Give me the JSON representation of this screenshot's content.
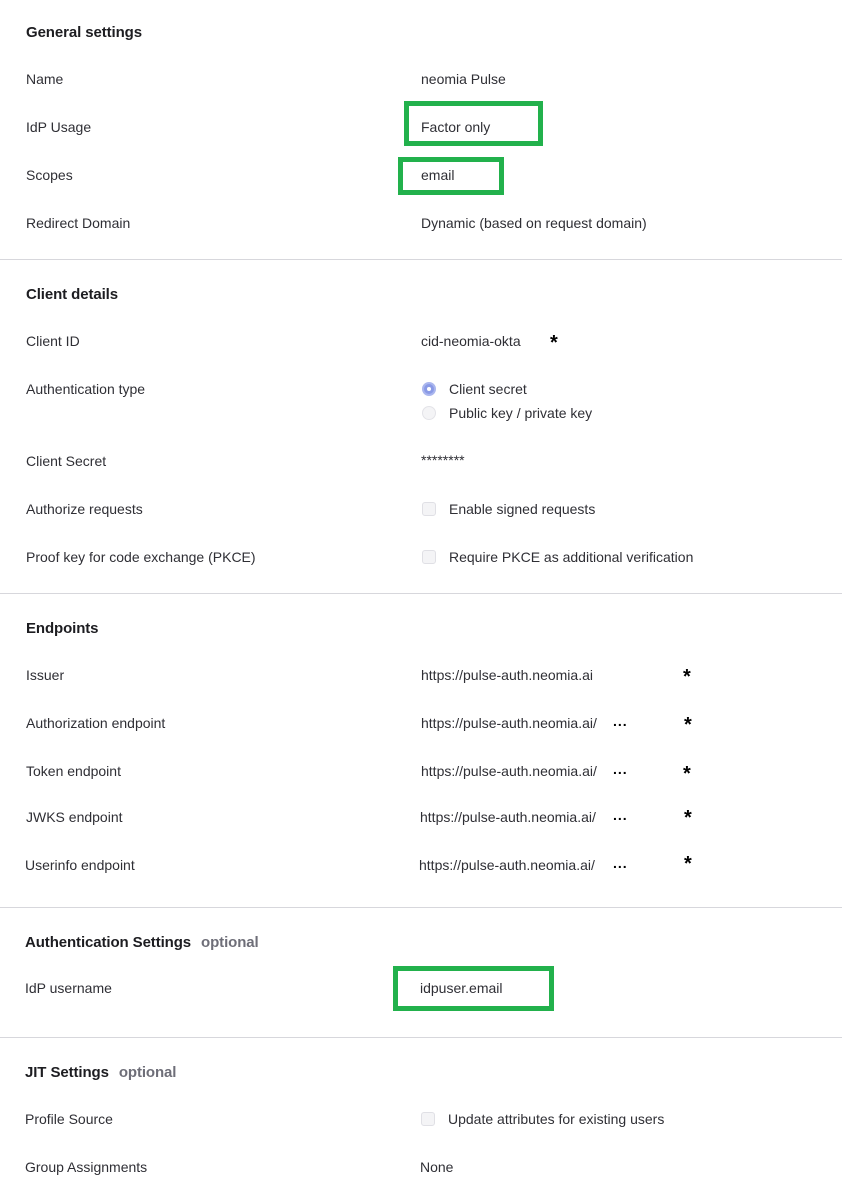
{
  "general": {
    "title": "General settings",
    "name_label": "Name",
    "name_value": "neomia Pulse",
    "idp_usage_label": "IdP Usage",
    "idp_usage_value": "Factor only",
    "scopes_label": "Scopes",
    "scopes_value": "email",
    "redirect_label": "Redirect Domain",
    "redirect_value": "Dynamic (based on request domain)"
  },
  "client": {
    "title": "Client details",
    "client_id_label": "Client ID",
    "client_id_value": "cid-neomia-okta",
    "auth_type_label": "Authentication type",
    "auth_type_options": [
      "Client secret",
      "Public key / private key"
    ],
    "auth_type_selected": "Client secret",
    "secret_label": "Client Secret",
    "secret_value": "********",
    "authorize_label": "Authorize requests",
    "authorize_option": "Enable signed requests",
    "pkce_label": "Proof key for code exchange (PKCE)",
    "pkce_option": "Require PKCE as additional verification"
  },
  "endpoints": {
    "title": "Endpoints",
    "issuer_label": "Issuer",
    "issuer_value": "https://pulse-auth.neomia.ai",
    "authorization_label": "Authorization endpoint",
    "authorization_value": "https://pulse-auth.neomia.ai/",
    "token_label": "Token endpoint",
    "token_value": "https://pulse-auth.neomia.ai/",
    "jwks_label": "JWKS endpoint",
    "jwks_value": "https://pulse-auth.neomia.ai/",
    "userinfo_label": "Userinfo endpoint",
    "userinfo_value": "https://pulse-auth.neomia.ai/"
  },
  "auth_settings": {
    "title": "Authentication Settings",
    "optional": "optional",
    "username_label": "IdP username",
    "username_value": "idpuser.email"
  },
  "jit": {
    "title": "JIT Settings",
    "optional": "optional",
    "profile_label": "Profile Source",
    "profile_option": "Update attributes for existing users",
    "group_label": "Group Assignments",
    "group_value": "None"
  },
  "glyphs": {
    "asterisk": "*",
    "ellipsis": "..."
  },
  "colors": {
    "highlight": "#22b14c",
    "radio_selected": "#8a9ae6"
  }
}
